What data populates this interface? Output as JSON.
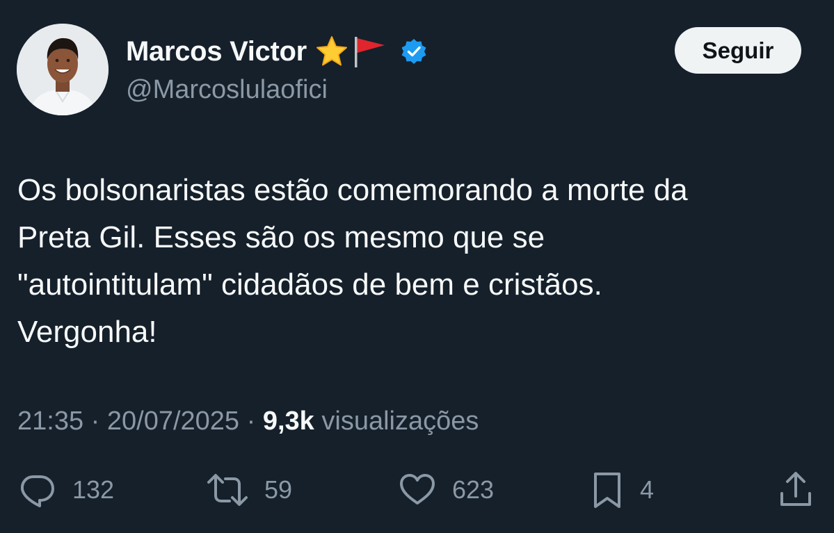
{
  "author": {
    "display_name": "Marcos Victor",
    "handle": "@Marcoslulaofici",
    "name_emojis": [
      "star-emoji",
      "red-flag-emoji"
    ],
    "verified": true,
    "verified_color": "#1d9bf0"
  },
  "follow_button": {
    "label": "Seguir"
  },
  "tweet": {
    "text_lines": [
      "Os bolsonaristas estão comemorando a morte da",
      "Preta Gil. Esses são os mesmo que se",
      "\"autointitulam\" cidadãos de bem e cristãos.",
      "Vergonha!"
    ],
    "time": "21:35",
    "separator": "·",
    "date": "20/07/2025",
    "views_count": "9,3k",
    "views_label": "visualizações"
  },
  "actions": {
    "replies": {
      "icon": "reply-icon",
      "count": "132"
    },
    "reposts": {
      "icon": "repost-icon",
      "count": "59"
    },
    "likes": {
      "icon": "heart-icon",
      "count": "623"
    },
    "bookmarks": {
      "icon": "bookmark-icon",
      "count": "4"
    },
    "share": {
      "icon": "share-icon"
    }
  },
  "colors": {
    "background": "#15202b",
    "primary_text": "#f7f9f9",
    "secondary_text": "#8b98a5",
    "button_bg": "#eff3f4"
  }
}
